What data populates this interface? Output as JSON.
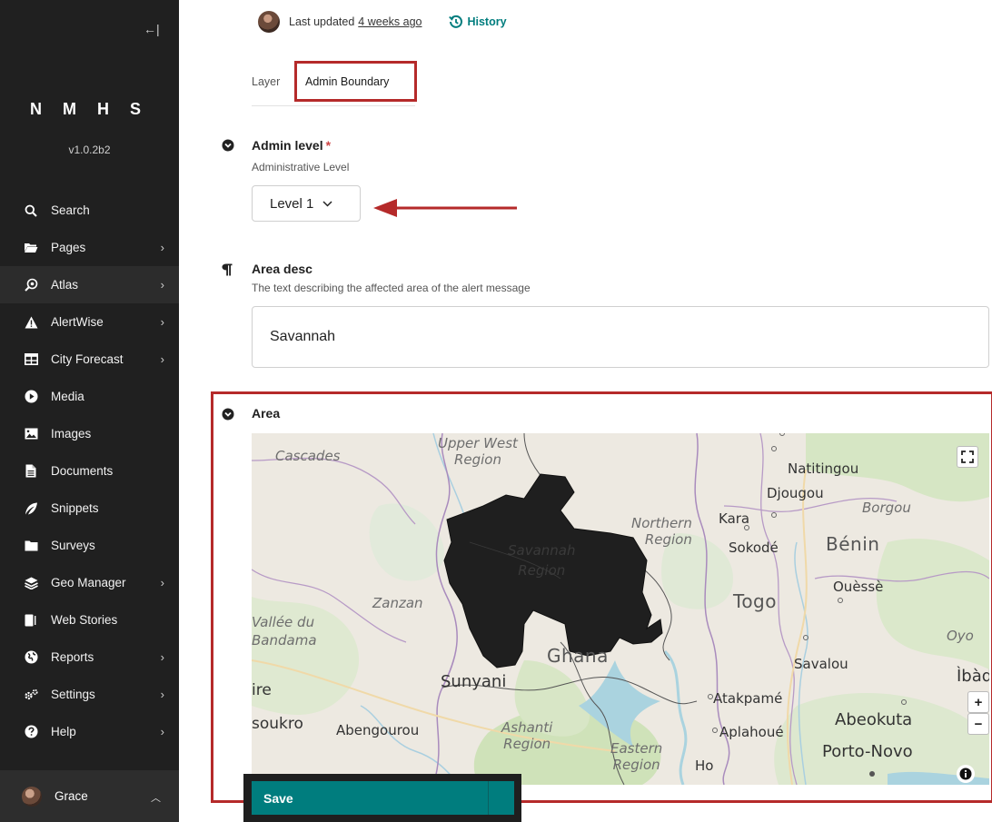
{
  "sidebar": {
    "collapse_glyph": "←|",
    "brand": "N M H S",
    "version": "v1.0.2b2",
    "items": [
      {
        "label": "Search",
        "icon": "search-icon",
        "has_submenu": false
      },
      {
        "label": "Pages",
        "icon": "folder-open-icon",
        "has_submenu": true
      },
      {
        "label": "Atlas",
        "icon": "atlas-search-icon",
        "has_submenu": true
      },
      {
        "label": "AlertWise",
        "icon": "warning-icon",
        "has_submenu": true
      },
      {
        "label": "City Forecast",
        "icon": "table-icon",
        "has_submenu": true
      },
      {
        "label": "Media",
        "icon": "play-icon",
        "has_submenu": false
      },
      {
        "label": "Images",
        "icon": "image-icon",
        "has_submenu": false
      },
      {
        "label": "Documents",
        "icon": "document-icon",
        "has_submenu": false
      },
      {
        "label": "Snippets",
        "icon": "snippet-icon",
        "has_submenu": false
      },
      {
        "label": "Surveys",
        "icon": "folder-icon",
        "has_submenu": false
      },
      {
        "label": "Geo Manager",
        "icon": "layers-icon",
        "has_submenu": true
      },
      {
        "label": "Web Stories",
        "icon": "stories-icon",
        "has_submenu": false
      },
      {
        "label": "Reports",
        "icon": "globe-icon",
        "has_submenu": true
      },
      {
        "label": "Settings",
        "icon": "cogs-icon",
        "has_submenu": true
      },
      {
        "label": "Help",
        "icon": "help-icon",
        "has_submenu": true
      }
    ],
    "user": {
      "name": "Grace"
    }
  },
  "header": {
    "updated_prefix": "Last updated",
    "updated_time": "4 weeks ago",
    "history_label": "History"
  },
  "tabs": [
    "Layer",
    "Admin Boundary"
  ],
  "admin_level": {
    "label": "Admin level",
    "required_mark": "*",
    "help": "Administrative Level",
    "selected": "Level 1"
  },
  "area_desc": {
    "label": "Area desc",
    "help": "The text describing the affected area of the alert message",
    "value": "Savannah"
  },
  "area": {
    "label": "Area",
    "map_labels": {
      "cascades": "Cascades",
      "upper_west": "Upper West\nRegion",
      "natitingou": "Natitingou",
      "djougou": "Djougou",
      "borgou": "Borgou",
      "kara": "Kara",
      "northern": "Northern\nRegion",
      "sokode": "Sokodé",
      "benin": "Bénin",
      "savannah": "Savannah\nRegion",
      "ouesse": "Ouèssè",
      "togo": "Togo",
      "vallee": "Vallée du\nBandama",
      "zanzan": "Zanzan",
      "oyo": "Oyo",
      "ghana": "Ghana",
      "savalou": "Savalou",
      "ibadan": "Ìbàd",
      "ire": "ire",
      "sunyani": "Sunyani",
      "atakpame": "Atakpamé",
      "abeokuta": "Abeokuta",
      "soukro": "soukro",
      "abengourou": "Abengourou",
      "ashanti": "Ashanti\nRegion",
      "aplahoue": "Aplahoué",
      "porto_novo": "Porto-Novo",
      "eastern": "Eastern\nRegion",
      "ho": "Ho"
    },
    "zoom_in": "+",
    "zoom_out": "−"
  },
  "footer": {
    "save_label": "Save"
  },
  "colors": {
    "accent": "#007d7e",
    "highlight": "#b52a2a",
    "sidebar_bg": "#202020"
  }
}
